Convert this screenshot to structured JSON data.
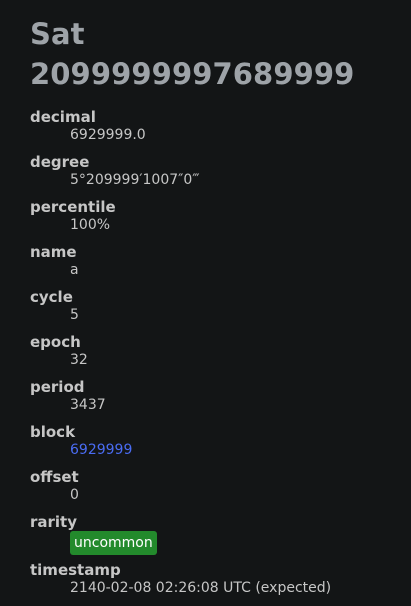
{
  "title": "Sat 2099999997689999",
  "fields": {
    "decimal": {
      "label": "decimal",
      "value": "6929999.0"
    },
    "degree": {
      "label": "degree",
      "value": "5°209999′1007″0‴"
    },
    "percentile": {
      "label": "percentile",
      "value": "100%"
    },
    "name": {
      "label": "name",
      "value": "a"
    },
    "cycle": {
      "label": "cycle",
      "value": "5"
    },
    "epoch": {
      "label": "epoch",
      "value": "32"
    },
    "period": {
      "label": "period",
      "value": "3437"
    },
    "block": {
      "label": "block",
      "value": "6929999"
    },
    "offset": {
      "label": "offset",
      "value": "0"
    },
    "rarity": {
      "label": "rarity",
      "value": "uncommon"
    },
    "timestamp": {
      "label": "timestamp",
      "value": "2140-02-08 02:26:08 UTC (expected)"
    }
  },
  "colors": {
    "background": "#131516",
    "title": "#9ea3a8",
    "text": "#c6c6c6",
    "link": "#4a6cf3",
    "rarity_badge": "#238a2c"
  }
}
